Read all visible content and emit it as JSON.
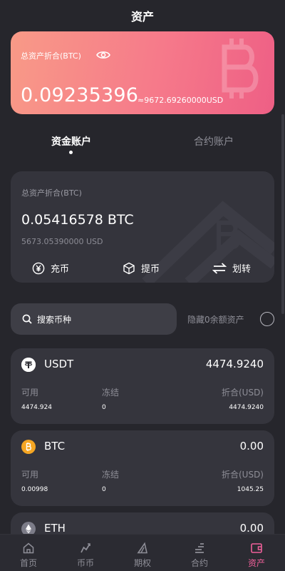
{
  "header": {
    "title": "资产"
  },
  "total": {
    "label": "总资产折合(BTC)",
    "btc_value": "0.09235396",
    "usd_value": "≈9672.69260000USD"
  },
  "tabs": [
    {
      "label": "资金账户",
      "active": true
    },
    {
      "label": "合约账户",
      "active": false
    }
  ],
  "account": {
    "label": "总资产折合(BTC)",
    "btc_value": "0.05416578 BTC",
    "usd_value": "5673.05390000 USD",
    "actions": {
      "deposit": "充币",
      "withdraw": "提币",
      "transfer": "划转"
    }
  },
  "search": {
    "placeholder": "搜索币种"
  },
  "hide_zero": {
    "label": "隐藏0余额资产",
    "checked": false
  },
  "asset_columns": {
    "available": "可用",
    "frozen": "冻结",
    "converted": "折合(USD)"
  },
  "assets": [
    {
      "name": "USDT",
      "total": "4474.9240",
      "available": "4474.924",
      "frozen": "0",
      "converted": "4474.9240",
      "icon": "usdt-icon",
      "color": "#ffffff"
    },
    {
      "name": "BTC",
      "total": "0.00",
      "available": "0.00998",
      "frozen": "0",
      "converted": "1045.25",
      "icon": "btc-icon",
      "color": "#f5a623"
    },
    {
      "name": "ETH",
      "total": "0.00",
      "icon": "eth-icon",
      "color": "#7c7c88"
    }
  ],
  "nav": [
    {
      "label": "首页",
      "icon": "home-icon",
      "active": false
    },
    {
      "label": "币币",
      "icon": "chart-icon",
      "active": false
    },
    {
      "label": "期权",
      "icon": "options-icon",
      "active": false
    },
    {
      "label": "合约",
      "icon": "contract-icon",
      "active": false
    },
    {
      "label": "资产",
      "icon": "wallet-icon",
      "active": true
    }
  ],
  "colors": {
    "accent": "#f0609a",
    "card_gradient_start": "#f89a87",
    "card_gradient_end": "#ee5f85",
    "background": "#26262c"
  }
}
